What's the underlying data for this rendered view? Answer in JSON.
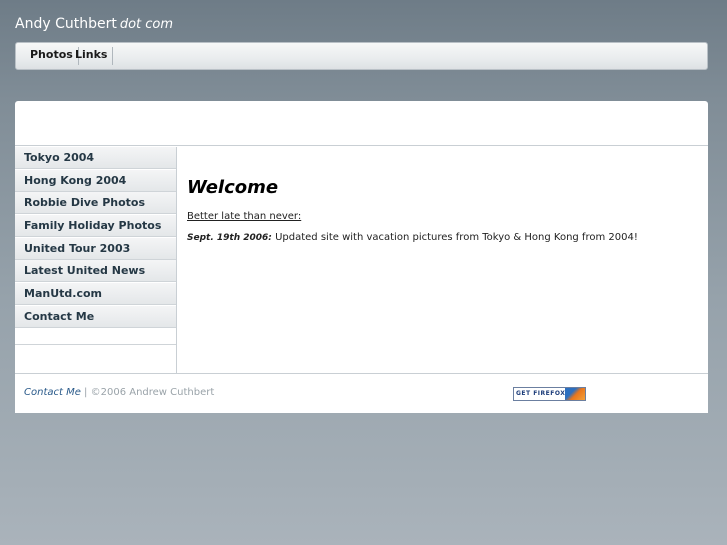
{
  "site": {
    "title": "Andy Cuthbert",
    "title_suffix": "dot com"
  },
  "topnav": {
    "tabs": [
      {
        "label": "Photos"
      },
      {
        "label": "Links"
      }
    ]
  },
  "sidebar": {
    "items": [
      {
        "label": "Tokyo 2004"
      },
      {
        "label": "Hong Kong 2004"
      },
      {
        "label": "Robbie Dive Photos"
      },
      {
        "label": "Family Holiday Photos"
      },
      {
        "label": "United Tour 2003"
      },
      {
        "label": "Latest United News"
      },
      {
        "label": "ManUtd.com"
      },
      {
        "label": "Contact Me"
      }
    ]
  },
  "main": {
    "heading": "Welcome",
    "tagline": "Better late than never:",
    "news": {
      "date": "Sept. 19th 2006:",
      "text": " Updated site with vacation pictures from Tokyo & Hong Kong from 2004!"
    }
  },
  "footer": {
    "contact_label": "Contact Me",
    "separator": " | ",
    "copyright": "©2006 Andrew Cuthbert",
    "badge_text": "GET FIREFOX"
  },
  "colors": {
    "link": "#2a5a8a",
    "sidebar_text": "#253845",
    "footer_text": "#9aa3a9"
  },
  "icons": {
    "badge_logo": "firefox-logo-icon"
  }
}
